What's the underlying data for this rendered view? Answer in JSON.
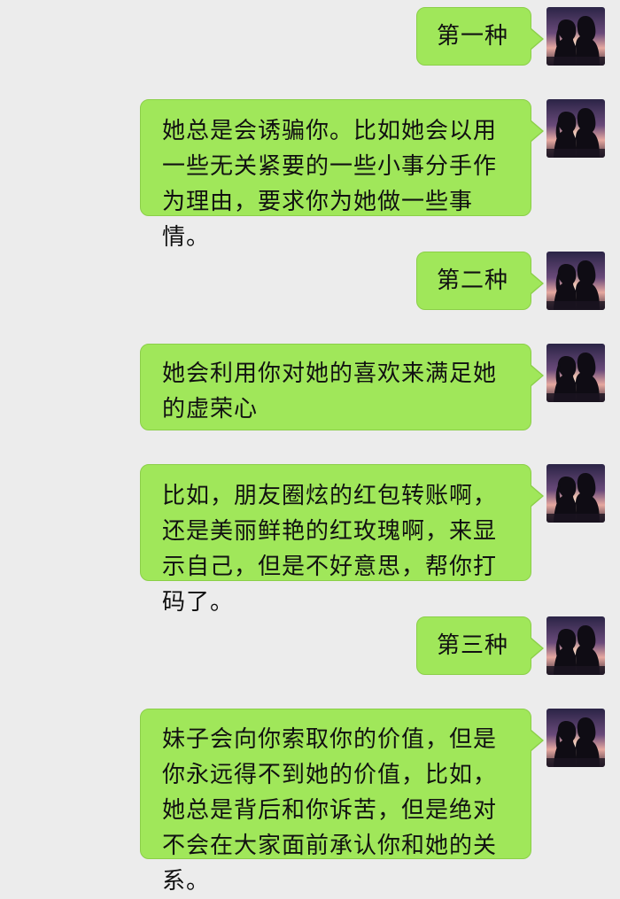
{
  "messages": [
    {
      "text": "第一种"
    },
    {
      "text": "她总是会诱骗你。比如她会以用一些无关紧要的一些小事分手作为理由，要求你为她做一些事情。"
    },
    {
      "text": "第二种"
    },
    {
      "text": "她会利用你对她的喜欢来满足她的虚荣心"
    },
    {
      "text": "比如，朋友圈炫的红包转账啊，还是美丽鲜艳的红玫瑰啊，来显示自己，但是不好意思，帮你打码了。"
    },
    {
      "text": "第三种"
    },
    {
      "text": "妹子会向你索取你的价值，但是你永远得不到她的价值，比如，她总是背后和你诉苦，但是绝对不会在大家面前承认你和她的关系。"
    }
  ],
  "avatar_icon": "couple-silhouette-sunset-avatar",
  "colors": {
    "background": "#ececec",
    "bubble": "#a0e75a",
    "bubble_border": "#8bcf48"
  }
}
